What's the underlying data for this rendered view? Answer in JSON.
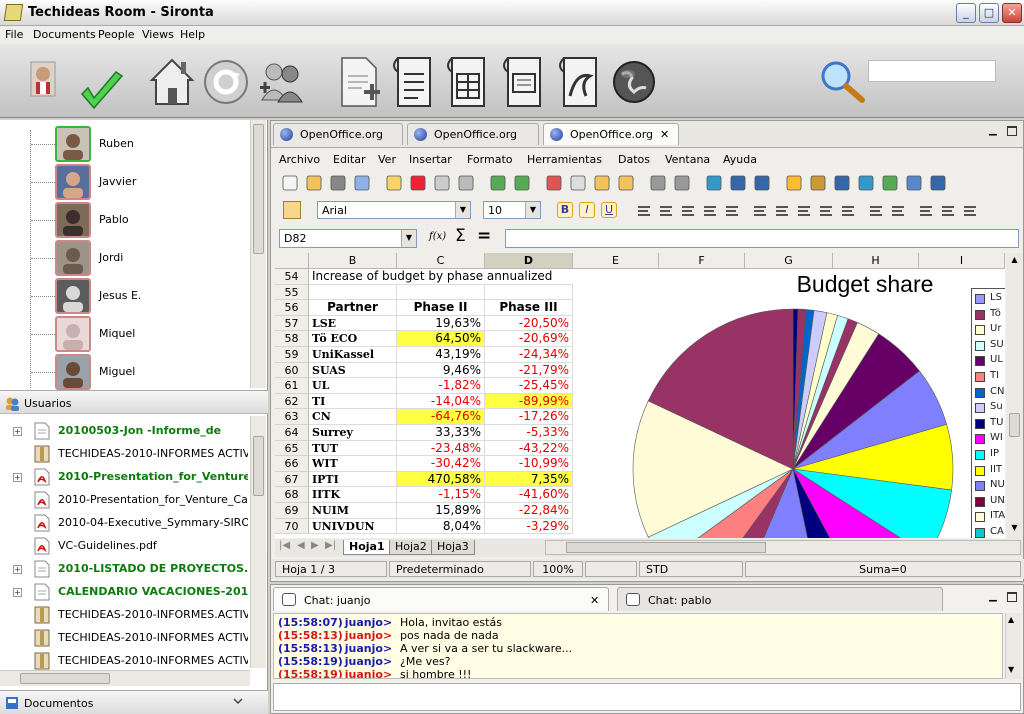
{
  "window": {
    "title": "Techideas Room - Sironta",
    "minimize": "_",
    "maximize": "□",
    "close": "✕"
  },
  "menu": [
    "File",
    "Documents",
    "People",
    "Views",
    "Help"
  ],
  "toolbar": {
    "search_value": ""
  },
  "users": {
    "header": "Usuarios",
    "items": [
      {
        "name": "Ruben",
        "selected": true
      },
      {
        "name": "Javvier",
        "selected": false
      },
      {
        "name": "Pablo",
        "selected": false
      },
      {
        "name": "Jordi",
        "selected": false
      },
      {
        "name": "Jesus E.",
        "selected": false
      },
      {
        "name": "Miquel",
        "selected": false
      },
      {
        "name": "Miguel",
        "selected": false
      }
    ]
  },
  "documents": {
    "header": "Documentos",
    "items": [
      {
        "label": "20100503-Jon          -Informe_de",
        "bold": true,
        "toggle": "+",
        "icon": "document-icon"
      },
      {
        "label": "TECHIDEAS-2010-INFORMES ACTIVIDA",
        "bold": false,
        "toggle": "",
        "icon": "archive-icon"
      },
      {
        "label": "2010-Presentation_for_Venture_",
        "bold": true,
        "toggle": "+",
        "icon": "pdf-icon"
      },
      {
        "label": "2010-Presentation_for_Venture_Capita",
        "bold": false,
        "toggle": "",
        "icon": "pdf-icon"
      },
      {
        "label": "2010-04-Executive_Symmary-SIRONTA",
        "bold": false,
        "toggle": "",
        "icon": "pdf-icon"
      },
      {
        "label": "VC-Guidelines.pdf",
        "bold": false,
        "toggle": "",
        "icon": "pdf-icon"
      },
      {
        "label": "2010-LISTADO DE PROYECTOS.ods",
        "bold": true,
        "toggle": "+",
        "icon": "document-icon"
      },
      {
        "label": "CALENDARIO VACACIONES-2010.od",
        "bold": true,
        "toggle": "+",
        "icon": "document-icon"
      },
      {
        "label": "TECHIDEAS-2010-INFORMES.ACTIVIDA",
        "bold": false,
        "toggle": "",
        "icon": "archive-icon"
      },
      {
        "label": "TECHIDEAS-2010-INFORMES ACTIVIDA",
        "bold": false,
        "toggle": "",
        "icon": "archive-icon"
      },
      {
        "label": "TECHIDEAS-2010-INFORMES ACTIVIDA",
        "bold": false,
        "toggle": "",
        "icon": "archive-icon"
      }
    ]
  },
  "office": {
    "tabs": [
      "OpenOffice.org",
      "OpenOffice.org",
      "OpenOffice.org"
    ],
    "tab_close": "✕",
    "menu": [
      "Archivo",
      "Editar",
      "Ver",
      "Insertar",
      "Formato",
      "Herramientas",
      "Datos",
      "Ventana",
      "Ayuda"
    ],
    "font_name": "Arial",
    "font_size": "10",
    "bold_btn": "B",
    "italic_btn": "I",
    "underline_btn": "U",
    "name_box": "D82",
    "formula_value": "",
    "sum_symbol": "Σ",
    "equals_symbol": "=",
    "fx_symbol": "f(x)",
    "columns": [
      "B",
      "C",
      "D",
      "E",
      "F",
      "G",
      "H",
      "I"
    ],
    "selected_column": "D",
    "rows": [
      {
        "num": "54",
        "b": "Increase of budget by phase annualized",
        "c": "",
        "d": "",
        "c_neg": false,
        "d_neg": false,
        "c_hl": false,
        "d_hl": false,
        "type": "title"
      },
      {
        "num": "55",
        "b": "",
        "c": "",
        "d": "",
        "c_neg": false,
        "d_neg": false,
        "c_hl": false,
        "d_hl": false,
        "type": "blank"
      },
      {
        "num": "56",
        "b": "Partner",
        "c": "Phase II",
        "d": "Phase III",
        "c_neg": false,
        "d_neg": false,
        "c_hl": false,
        "d_hl": false,
        "type": "header"
      },
      {
        "num": "57",
        "b": "LSE",
        "c": "19,63%",
        "d": "-20,50%",
        "c_neg": false,
        "d_neg": true,
        "c_hl": false,
        "d_hl": false,
        "type": "data"
      },
      {
        "num": "58",
        "b": "Tö ECO",
        "c": "64,50%",
        "d": "-20,69%",
        "c_neg": false,
        "d_neg": true,
        "c_hl": true,
        "d_hl": false,
        "type": "data"
      },
      {
        "num": "59",
        "b": "UniKassel",
        "c": "43,19%",
        "d": "-24,34%",
        "c_neg": false,
        "d_neg": true,
        "c_hl": false,
        "d_hl": false,
        "type": "data"
      },
      {
        "num": "60",
        "b": "SUAS",
        "c": "9,46%",
        "d": "-21,79%",
        "c_neg": false,
        "d_neg": true,
        "c_hl": false,
        "d_hl": false,
        "type": "data"
      },
      {
        "num": "61",
        "b": "UL",
        "c": "-1,82%",
        "d": "-25,45%",
        "c_neg": true,
        "d_neg": true,
        "c_hl": false,
        "d_hl": false,
        "type": "data"
      },
      {
        "num": "62",
        "b": "TI",
        "c": "-14,04%",
        "d": "-89,99%",
        "c_neg": true,
        "d_neg": true,
        "c_hl": false,
        "d_hl": true,
        "type": "data"
      },
      {
        "num": "63",
        "b": "CN",
        "c": "-64,76%",
        "d": "-17,26%",
        "c_neg": true,
        "d_neg": true,
        "c_hl": true,
        "d_hl": false,
        "type": "data"
      },
      {
        "num": "64",
        "b": "Surrey",
        "c": "33,33%",
        "d": "-5,33%",
        "c_neg": false,
        "d_neg": true,
        "c_hl": false,
        "d_hl": false,
        "type": "data"
      },
      {
        "num": "65",
        "b": "TUT",
        "c": "-23,48%",
        "d": "-43,22%",
        "c_neg": true,
        "d_neg": true,
        "c_hl": false,
        "d_hl": false,
        "type": "data"
      },
      {
        "num": "66",
        "b": "WIT",
        "c": "-30,42%",
        "d": "-10,99%",
        "c_neg": true,
        "d_neg": true,
        "c_hl": false,
        "d_hl": false,
        "type": "data"
      },
      {
        "num": "67",
        "b": "IPTI",
        "c": "470,58%",
        "d": "7,35%",
        "c_neg": false,
        "d_neg": false,
        "c_hl": true,
        "d_hl": true,
        "type": "data"
      },
      {
        "num": "68",
        "b": "IITK",
        "c": "-1,15%",
        "d": "-41,60%",
        "c_neg": true,
        "d_neg": true,
        "c_hl": false,
        "d_hl": false,
        "type": "data"
      },
      {
        "num": "69",
        "b": "NUIM",
        "c": "15,89%",
        "d": "-22,84%",
        "c_neg": false,
        "d_neg": true,
        "c_hl": false,
        "d_hl": false,
        "type": "data"
      },
      {
        "num": "70",
        "b": "UNIVDUN",
        "c": "8,04%",
        "d": "-3,29%",
        "c_neg": false,
        "d_neg": true,
        "c_hl": false,
        "d_hl": false,
        "type": "data"
      }
    ],
    "sheets": [
      "Hoja1",
      "Hoja2",
      "Hoja3"
    ],
    "status": {
      "sheet": "Hoja 1 / 3",
      "style": "Predeterminado",
      "zoom": "100%",
      "mode": "STD",
      "sum": "Suma=0"
    }
  },
  "chart_data": {
    "type": "pie",
    "title": "Budget share",
    "legend_position": "right",
    "legend_labels": [
      "LS",
      "Tö",
      "Ur",
      "SU",
      "UL",
      "TI",
      "CN",
      "Su",
      "TU",
      "WI",
      "IP",
      "IIT",
      "NU",
      "UN",
      "ITA",
      "CA"
    ],
    "colors": [
      "#9999ff",
      "#993366",
      "#ffffcc",
      "#ccffff",
      "#660066",
      "#ff8080",
      "#0066cc",
      "#ccccff",
      "#000080",
      "#ff00ff",
      "#00ffff",
      "#ffff00",
      "#8080ff",
      "#800040",
      "#fffbd6",
      "#00cccc"
    ],
    "values": [
      0.5,
      0.8,
      0.8,
      1.3,
      1.1,
      1.1,
      1.0,
      2.4,
      5.5,
      6.0,
      6.6,
      7.0,
      8.1,
      4.5,
      9.7,
      3.6,
      5.0,
      3.0,
      14.0,
      18.0
    ],
    "slice_colors": [
      "#000080",
      "#993366",
      "#0066cc",
      "#ccccff",
      "#ffffcc",
      "#ccffff",
      "#993366",
      "#fffbd6",
      "#660066",
      "#8080ff",
      "#ffff00",
      "#00ffff",
      "#ff00ff",
      "#000080",
      "#8080ff",
      "#993366",
      "#ff8080",
      "#ccffff",
      "#fffbd6",
      "#993366"
    ]
  },
  "chat": {
    "tabs": [
      "Chat: juanjo",
      "Chat: pablo"
    ],
    "tab_close": "✕",
    "messages": [
      {
        "time": "(15:58:07)",
        "user": "juanjo>",
        "text": "Hola, invitao estás",
        "color": "#1a1aaa"
      },
      {
        "time": "(15:58:13)",
        "user": "juanjo>",
        "text": "pos nada de nada",
        "color": "#d21a1a"
      },
      {
        "time": "(15:58:13)",
        "user": "juanjo>",
        "text": "A ver si va a ser tu slackware...",
        "color": "#1a1aaa"
      },
      {
        "time": "(15:58:19)",
        "user": "juanjo>",
        "text": "¿Me ves?",
        "color": "#1a1aaa"
      },
      {
        "time": "(15:58:19)",
        "user": "juanjo>",
        "text": "si hombre !!!",
        "color": "#d21a1a"
      }
    ],
    "input_value": ""
  }
}
